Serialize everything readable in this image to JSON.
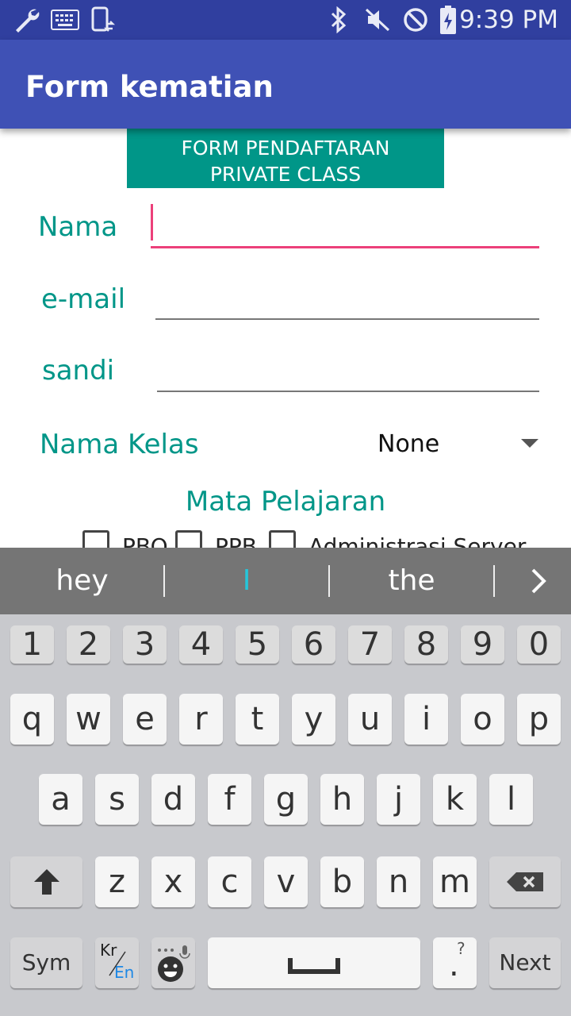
{
  "status_bar": {
    "time": "9:39 PM",
    "icons": [
      "wrench-icon",
      "keyboard-icon",
      "phone-sync-icon",
      "bluetooth-icon",
      "mute-icon",
      "do-not-disturb-icon",
      "battery-charging-icon"
    ]
  },
  "app_bar": {
    "title": "Form kematian"
  },
  "form": {
    "header_line1": "FORM PENDAFTARAN",
    "header_line2": "PRIVATE CLASS",
    "nama_label": "Nama",
    "nama_value": "",
    "email_label": "e-mail",
    "email_value": "",
    "sandi_label": "sandi",
    "sandi_value": "",
    "kelas_label": "Nama Kelas",
    "kelas_selected": "None",
    "mapel_label": "Mata Pelajaran",
    "checkboxes": [
      {
        "label": "PBO",
        "checked": false
      },
      {
        "label": "PPB",
        "checked": false
      },
      {
        "label": "Administrasi Server",
        "checked": false
      }
    ]
  },
  "keyboard": {
    "suggestions": [
      "hey",
      "I",
      "the"
    ],
    "row_numbers": [
      "1",
      "2",
      "3",
      "4",
      "5",
      "6",
      "7",
      "8",
      "9",
      "0"
    ],
    "row1": [
      "q",
      "w",
      "e",
      "r",
      "t",
      "y",
      "u",
      "i",
      "o",
      "p"
    ],
    "row2": [
      "a",
      "s",
      "d",
      "f",
      "g",
      "h",
      "j",
      "k",
      "l"
    ],
    "row3": [
      "z",
      "x",
      "c",
      "v",
      "b",
      "n",
      "m"
    ],
    "sym_label": "Sym",
    "lang_top": "Kr",
    "lang_bottom": "En",
    "period_label": ".",
    "period_hint": "?",
    "next_label": "Next"
  }
}
